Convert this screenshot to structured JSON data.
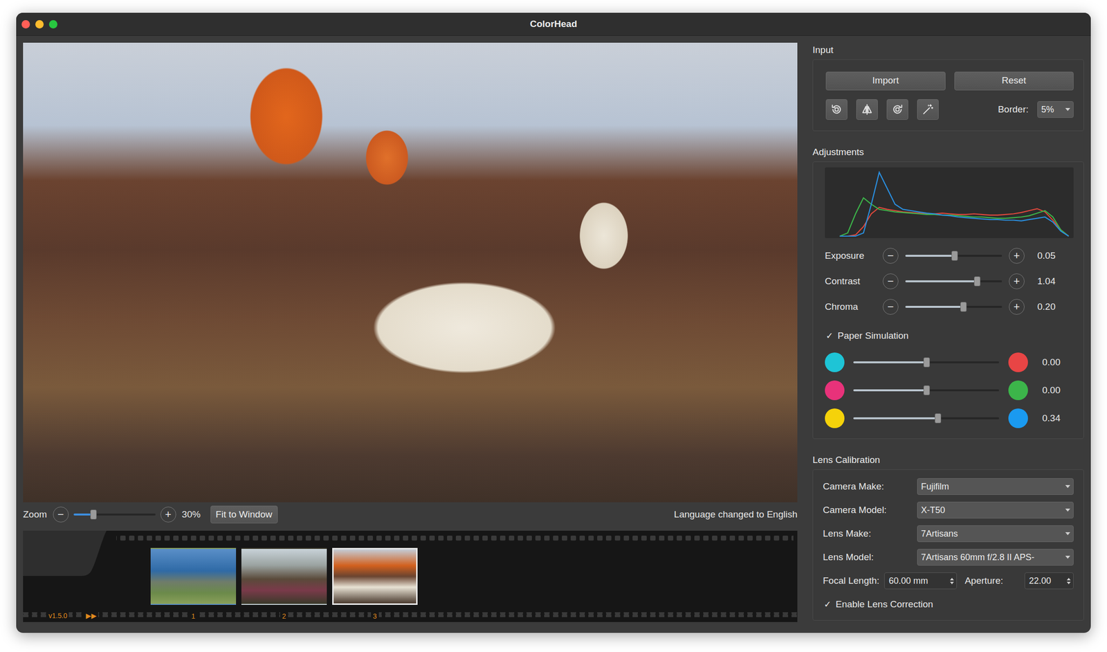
{
  "window": {
    "title": "ColorHead"
  },
  "viewer": {
    "zoom_label": "Zoom",
    "zoom_minus": "−",
    "zoom_plus": "+",
    "zoom_level": 0.24,
    "zoom_value": "30%",
    "fit_button": "Fit to Window",
    "status": "Language changed to English"
  },
  "filmstrip": {
    "version": "v1.5.0",
    "play": "▶▶",
    "frames": [
      {
        "number": "1",
        "selected": false
      },
      {
        "number": "2",
        "selected": false
      },
      {
        "number": "3",
        "selected": true
      }
    ]
  },
  "input": {
    "title": "Input",
    "buttons": [
      "Import",
      "Reset"
    ],
    "border_label": "Border:",
    "border_value": "5%"
  },
  "adjustments": {
    "title": "Adjustments",
    "histogram": {
      "series": [
        {
          "name": "red",
          "color": "#e0483c",
          "values": [
            0,
            0,
            0.02,
            0.15,
            0.35,
            0.45,
            0.42,
            0.4,
            0.38,
            0.37,
            0.36,
            0.35,
            0.35,
            0.36,
            0.35,
            0.34,
            0.34,
            0.35,
            0.34,
            0.33,
            0.33,
            0.34,
            0.35,
            0.37,
            0.4,
            0.43,
            0.38,
            0.25,
            0.1,
            0
          ]
        },
        {
          "name": "green",
          "color": "#3cb54a",
          "values": [
            0,
            0.05,
            0.35,
            0.6,
            0.5,
            0.42,
            0.4,
            0.38,
            0.37,
            0.36,
            0.35,
            0.34,
            0.34,
            0.33,
            0.33,
            0.32,
            0.31,
            0.3,
            0.3,
            0.29,
            0.28,
            0.28,
            0.29,
            0.3,
            0.32,
            0.36,
            0.4,
            0.3,
            0.1,
            0
          ]
        },
        {
          "name": "blue",
          "color": "#2a8fe0",
          "values": [
            0,
            0,
            0,
            0.05,
            0.5,
            1.0,
            0.75,
            0.5,
            0.42,
            0.4,
            0.38,
            0.36,
            0.35,
            0.33,
            0.32,
            0.3,
            0.29,
            0.28,
            0.27,
            0.26,
            0.26,
            0.25,
            0.25,
            0.24,
            0.26,
            0.28,
            0.3,
            0.22,
            0.08,
            0
          ]
        }
      ]
    },
    "minus": "−",
    "plus": "+",
    "sliders": [
      {
        "label": "Exposure",
        "level": 0.51,
        "value": "0.05"
      },
      {
        "label": "Contrast",
        "level": 0.74,
        "value": "1.04"
      },
      {
        "label": "Chroma",
        "level": 0.6,
        "value": "0.20"
      }
    ],
    "paper_simulation": {
      "label": "Paper Simulation",
      "mark": "✓",
      "checked": true
    },
    "balance": [
      {
        "from_color": "#1ec4d6",
        "to_color": "#e84545",
        "level": 0.5,
        "value": "0.00"
      },
      {
        "from_color": "#e8327a",
        "to_color": "#3cb54a",
        "level": 0.5,
        "value": "0.00"
      },
      {
        "from_color": "#f5d20a",
        "to_color": "#1a9af0",
        "level": 0.58,
        "value": "0.34"
      }
    ]
  },
  "lens": {
    "title": "Lens Calibration",
    "dropdowns": [
      {
        "label": "Camera Make:",
        "value": "Fujifilm"
      },
      {
        "label": "Camera Model:",
        "value": "X-T50"
      },
      {
        "label": "Lens Make:",
        "value": "7Artisans"
      },
      {
        "label": "Lens Model:",
        "value": "7Artisans 60mm f/2.8 II APS-"
      }
    ],
    "focal": {
      "label": "Focal Length:",
      "value": "60.00 mm"
    },
    "aperture": {
      "label": "Aperture:",
      "value": "22.00"
    },
    "enable": {
      "label": "Enable Lens Correction",
      "mark": "✓",
      "checked": true
    }
  }
}
